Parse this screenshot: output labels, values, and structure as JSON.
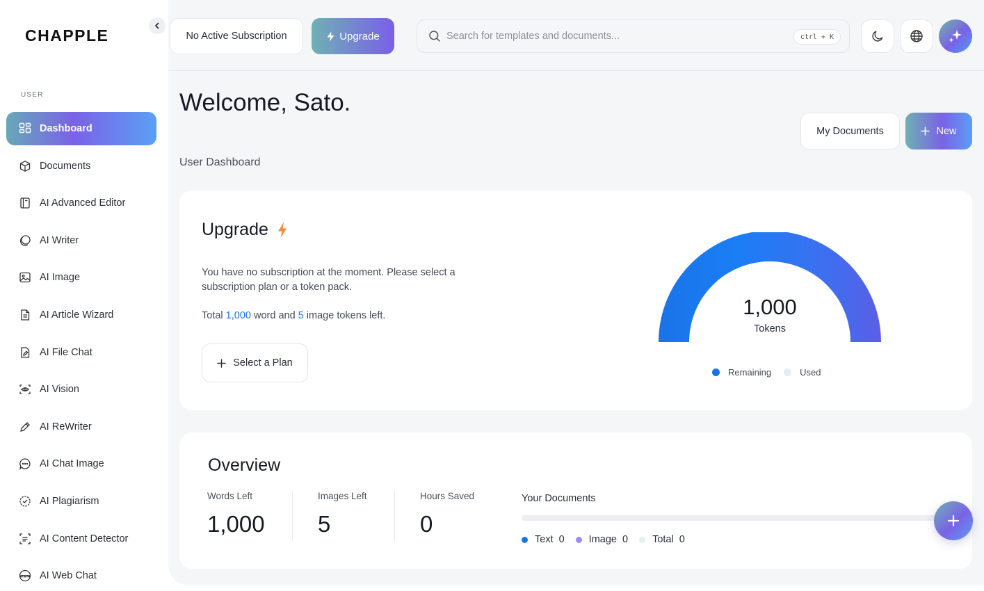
{
  "sidebar": {
    "logo": "CHAPPLE",
    "section_label": "USER",
    "items": [
      {
        "label": "Dashboard",
        "icon": "grid-icon",
        "active": true
      },
      {
        "label": "Documents",
        "icon": "cube-icon"
      },
      {
        "label": "AI Advanced Editor",
        "icon": "notebook-icon"
      },
      {
        "label": "AI Writer",
        "icon": "circles-icon"
      },
      {
        "label": "AI Image",
        "icon": "image-icon"
      },
      {
        "label": "AI Article Wizard",
        "icon": "document-icon"
      },
      {
        "label": "AI File Chat",
        "icon": "file-edit-icon"
      },
      {
        "label": "AI Vision",
        "icon": "eye-scan-icon"
      },
      {
        "label": "AI ReWriter",
        "icon": "pen-icon"
      },
      {
        "label": "AI Chat Image",
        "icon": "chat-bubble-icon"
      },
      {
        "label": "AI Plagiarism",
        "icon": "badge-check-icon"
      },
      {
        "label": "AI Content Detector",
        "icon": "scan-text-icon"
      },
      {
        "label": "AI Web Chat",
        "icon": "www-icon"
      }
    ]
  },
  "topbar": {
    "subscription_label": "No Active Subscription",
    "upgrade_label": "Upgrade",
    "search_placeholder": "Search for templates and documents...",
    "search_shortcut": "ctrl + K"
  },
  "header": {
    "welcome": "Welcome, Sato.",
    "subtitle": "User Dashboard",
    "my_documents_label": "My Documents",
    "new_label": "New"
  },
  "upgrade_card": {
    "title": "Upgrade",
    "description": "You have no subscription at the moment. Please select a subscription plan or a token pack.",
    "tokens_prefix": "Total",
    "word_tokens": "1,000",
    "tokens_middle": "word and",
    "image_tokens": "5",
    "tokens_suffix": "image tokens left.",
    "select_plan_label": "Select a Plan",
    "gauge_value": "1,000",
    "gauge_unit": "Tokens",
    "gauge_remaining_fraction": 1.0,
    "legend_remaining": "Remaining",
    "legend_used": "Used",
    "colors": {
      "remaining": "#1a73e8",
      "used": "#e3ecf8"
    }
  },
  "overview": {
    "title": "Overview",
    "stats": [
      {
        "label": "Words Left",
        "value": "1,000"
      },
      {
        "label": "Images Left",
        "value": "5"
      },
      {
        "label": "Hours Saved",
        "value": "0"
      }
    ],
    "documents_title": "Your Documents",
    "documents_legend": [
      {
        "label": "Text",
        "value": "0",
        "color": "#1a73e8"
      },
      {
        "label": "Image",
        "value": "0",
        "color": "#9a8cf0"
      },
      {
        "label": "Total",
        "value": "0",
        "color": "#e2f1ee"
      }
    ]
  }
}
